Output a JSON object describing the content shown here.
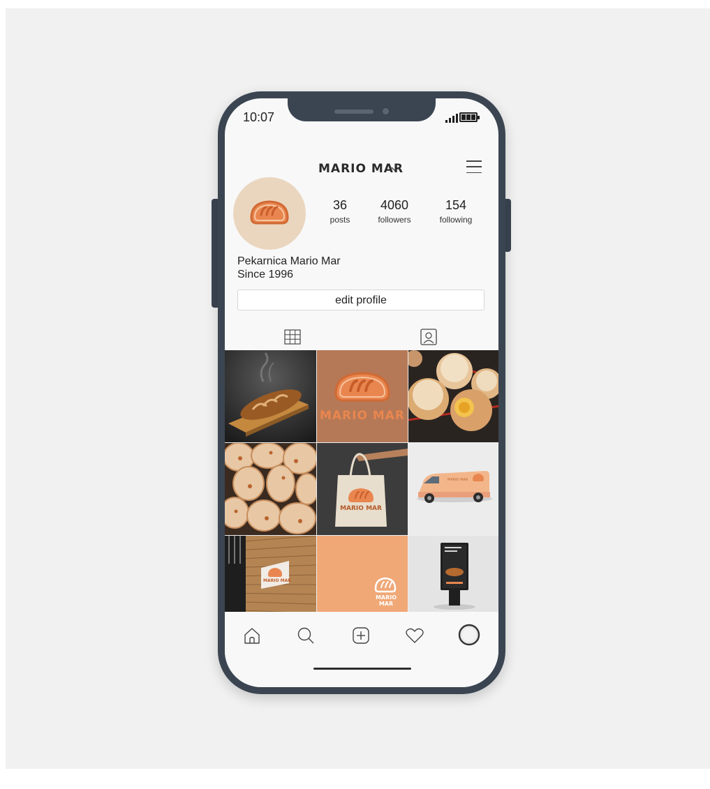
{
  "status_bar": {
    "time": "10:07"
  },
  "header": {
    "username": "MARIO MAR",
    "chevron": "v"
  },
  "profile": {
    "stats": [
      {
        "value": "36",
        "label": "posts"
      },
      {
        "value": "4060",
        "label": "followers"
      },
      {
        "value": "154",
        "label": "following"
      }
    ],
    "bio_line1": "Pekarnica Mario Mar",
    "bio_line2": "Since 1996",
    "edit_label": "edit profile"
  },
  "posts": [
    {
      "subject": "loaf of bread on wooden board"
    },
    {
      "subject": "Mario Mar logo on brown",
      "logo_text": "MARIO MAR"
    },
    {
      "subject": "jam filled doughnuts"
    },
    {
      "subject": "cheese bread rolls"
    },
    {
      "subject": "branded tote bag",
      "logo_text": "MARIO MAR"
    },
    {
      "subject": "branded delivery van",
      "logo_text": "MARIO MAR"
    },
    {
      "subject": "wall sign on brick building",
      "logo_text": "MARIO MAR"
    },
    {
      "subject": "logo on peach background",
      "logo_text": "MARIO MAR"
    },
    {
      "subject": "street advertising stand"
    }
  ],
  "bottom_nav": [
    "home-icon",
    "search-icon",
    "add-post-icon",
    "heart-icon",
    "profile-avatar-icon"
  ],
  "colors": {
    "brand_orange": "#e9864f",
    "brand_brown": "#b57957",
    "phone_frame": "#3b4552",
    "peach": "#f0a877"
  }
}
